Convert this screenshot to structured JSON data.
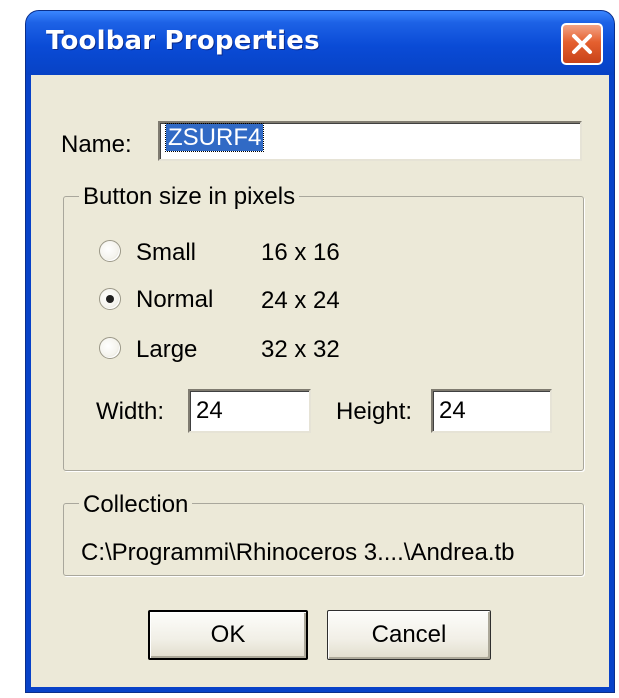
{
  "window": {
    "title": "Toolbar Properties"
  },
  "name_field": {
    "label": "Name:",
    "value": "ZSURF4"
  },
  "button_size": {
    "legend": "Button size in pixels",
    "options": [
      {
        "label": "Small",
        "size": "16 x 16",
        "selected": false
      },
      {
        "label": "Normal",
        "size": "24 x 24",
        "selected": true
      },
      {
        "label": "Large",
        "size": "32 x 32",
        "selected": false
      }
    ],
    "width_label": "Width:",
    "width_value": "24",
    "height_label": "Height:",
    "height_value": "24"
  },
  "collection": {
    "legend": "Collection",
    "path": "C:\\Programmi\\Rhinoceros 3....\\Andrea.tb"
  },
  "buttons": {
    "ok": "OK",
    "cancel": "Cancel"
  },
  "colors": {
    "titlebar": "#0a4bd6",
    "dialog_bg": "#ece9d8",
    "close_button": "#e5602f",
    "selection": "#316ac5"
  },
  "icons": {
    "close": "close-icon"
  }
}
